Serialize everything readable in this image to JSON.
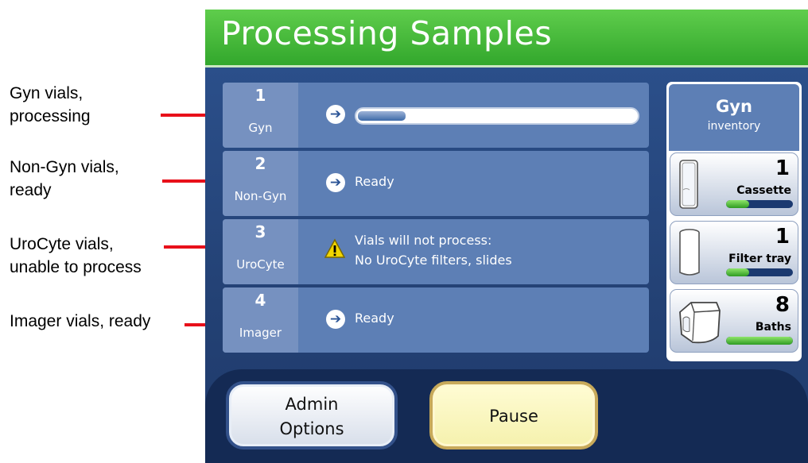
{
  "annotations": [
    {
      "line1": "Gyn vials,",
      "line2": "processing"
    },
    {
      "line1": "Non-Gyn vials,",
      "line2": "ready"
    },
    {
      "line1": "UroCyte vials,",
      "line2": "unable to process"
    },
    {
      "line1": "Imager vials, ready",
      "line2": ""
    }
  ],
  "screen": {
    "title": "Processing Samples",
    "colors": {
      "title_green": "#3fb533",
      "navy": "#1e3a70",
      "row": "#5d7fb5",
      "warning": "#f2d600"
    },
    "rows": [
      {
        "number": "1",
        "name": "Gyn",
        "status": "",
        "progress_fraction": 0.17,
        "icon": "arrow-circle-icon"
      },
      {
        "number": "2",
        "name": "Non-Gyn",
        "status": "Ready",
        "icon": "arrow-circle-icon"
      },
      {
        "number": "3",
        "name": "UroCyte",
        "status_line1": "Vials will not process:",
        "status_line2": "No UroCyte filters, slides",
        "icon": "warning-icon"
      },
      {
        "number": "4",
        "name": "Imager",
        "status": "Ready",
        "icon": "arrow-circle-icon"
      }
    ],
    "inventory": {
      "title": "Gyn",
      "subtitle": "inventory",
      "items": [
        {
          "count": "1",
          "label": "Cassette",
          "level_fraction": 0.35,
          "icon": "cassette-icon"
        },
        {
          "count": "1",
          "label": "Filter tray",
          "level_fraction": 0.35,
          "icon": "filter-tray-icon"
        },
        {
          "count": "8",
          "label": "Baths",
          "level_fraction": 1.0,
          "icon": "bath-icon"
        }
      ]
    },
    "buttons": {
      "admin_line1": "Admin",
      "admin_line2": "Options",
      "pause": "Pause"
    }
  }
}
